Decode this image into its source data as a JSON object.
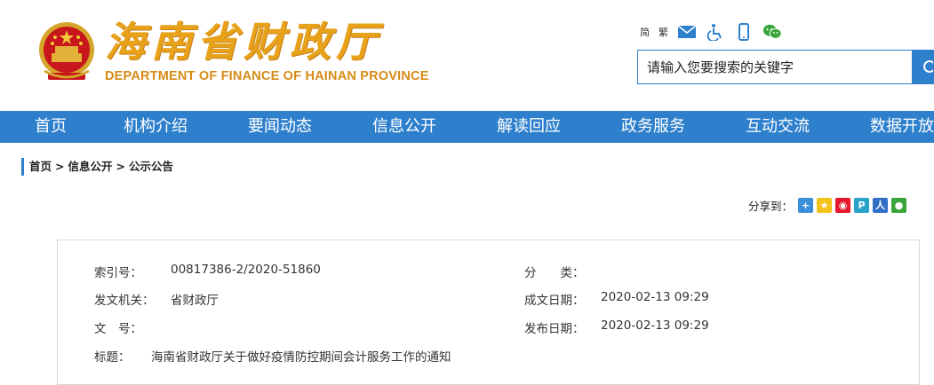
{
  "header": {
    "logo_cn": "海南省财政厅",
    "logo_en": "DEPARTMENT OF FINANCE OF HAINAN PROVINCE",
    "tools": {
      "simplified": "简",
      "traditional": "繁"
    },
    "search": {
      "placeholder": "请输入您要搜索的关键字"
    }
  },
  "nav": {
    "items": [
      {
        "label": "首页"
      },
      {
        "label": "机构介绍"
      },
      {
        "label": "要闻动态"
      },
      {
        "label": "信息公开"
      },
      {
        "label": "解读回应"
      },
      {
        "label": "政务服务"
      },
      {
        "label": "互动交流"
      },
      {
        "label": "数据开放"
      }
    ]
  },
  "breadcrumb": {
    "home": "首页",
    "sep": ">",
    "level1": "信息公开",
    "level2": "公示公告"
  },
  "share": {
    "label": "分享到："
  },
  "info": {
    "index_label": "索引号：",
    "index_value": "00817386-2/2020-51860",
    "category_label": "分　　类：",
    "category_value": "",
    "issuer_label": "发文机关：",
    "issuer_value": "省财政厅",
    "created_label": "成文日期：",
    "created_value": "2020-02-13 09:29",
    "docno_label": "文　号：",
    "docno_value": "",
    "published_label": "发布日期：",
    "published_value": "2020-02-13 09:29",
    "title_label": "标题：",
    "title_value": "海南省财政厅关于做好疫情防控期间会计服务工作的通知"
  },
  "colors": {
    "brand_blue": "#2e7fcc",
    "logo_gold": "#e8a21a",
    "emblem_red": "#c8161d"
  }
}
